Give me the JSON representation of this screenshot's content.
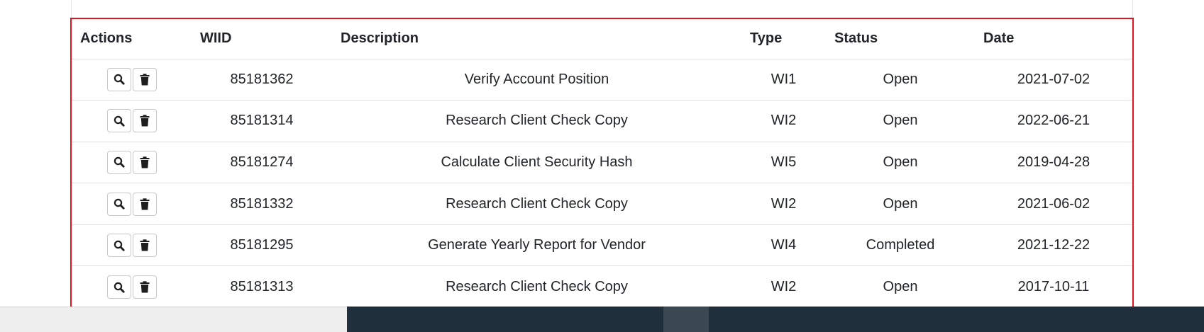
{
  "table": {
    "columns": {
      "actions": "Actions",
      "wiid": "WIID",
      "description": "Description",
      "type": "Type",
      "status": "Status",
      "date": "Date"
    },
    "rows": [
      {
        "wiid": "85181362",
        "description": "Verify Account Position",
        "type": "WI1",
        "status": "Open",
        "date": "2021-07-02"
      },
      {
        "wiid": "85181314",
        "description": "Research Client Check Copy",
        "type": "WI2",
        "status": "Open",
        "date": "2022-06-21"
      },
      {
        "wiid": "85181274",
        "description": "Calculate Client Security Hash",
        "type": "WI5",
        "status": "Open",
        "date": "2019-04-28"
      },
      {
        "wiid": "85181332",
        "description": "Research Client Check Copy",
        "type": "WI2",
        "status": "Open",
        "date": "2021-06-02"
      },
      {
        "wiid": "85181295",
        "description": "Generate Yearly Report for Vendor",
        "type": "WI4",
        "status": "Completed",
        "date": "2021-12-22"
      },
      {
        "wiid": "85181313",
        "description": "Research Client Check Copy",
        "type": "WI2",
        "status": "Open",
        "date": "2017-10-11"
      }
    ],
    "row_actions": {
      "view_icon": "search-icon",
      "delete_icon": "trash-icon"
    }
  },
  "colors": {
    "highlight_border": "#e0141e",
    "taskbar_dark": "#1f2f3b",
    "taskbar_light": "#eeeeee"
  }
}
